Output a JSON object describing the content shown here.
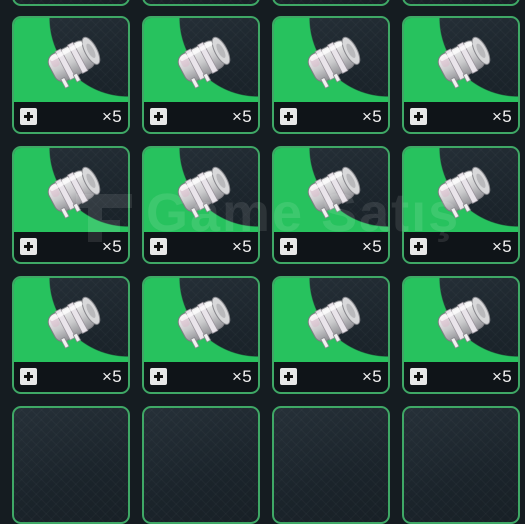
{
  "inventory": {
    "slots": [
      {
        "quantity": "×5",
        "item_icon": "scroll-bundle-icon"
      },
      {
        "quantity": "×5",
        "item_icon": "scroll-bundle-icon"
      },
      {
        "quantity": "×5",
        "item_icon": "scroll-bundle-icon"
      },
      {
        "quantity": "×5",
        "item_icon": "scroll-bundle-icon"
      },
      {
        "quantity": "×5",
        "item_icon": "scroll-bundle-icon"
      },
      {
        "quantity": "×5",
        "item_icon": "scroll-bundle-icon"
      },
      {
        "quantity": "×5",
        "item_icon": "scroll-bundle-icon"
      },
      {
        "quantity": "×5",
        "item_icon": "scroll-bundle-icon"
      },
      {
        "quantity": "×5",
        "item_icon": "scroll-bundle-icon"
      },
      {
        "quantity": "×5",
        "item_icon": "scroll-bundle-icon"
      },
      {
        "quantity": "×5",
        "item_icon": "scroll-bundle-icon"
      },
      {
        "quantity": "×5",
        "item_icon": "scroll-bundle-icon"
      }
    ],
    "rarity_color": "#27c25e",
    "border_color": "#3fa866"
  },
  "watermark": {
    "text": "Game Satış"
  }
}
